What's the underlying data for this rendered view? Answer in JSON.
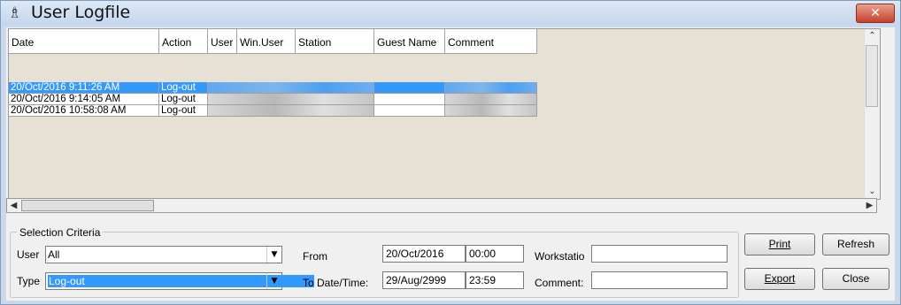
{
  "window": {
    "title": "User Logfile",
    "title_icon": "key-icon",
    "close_icon": "close-icon"
  },
  "grid": {
    "columns": [
      "Date",
      "Action",
      "User",
      "Win.User",
      "Station",
      "Guest Name",
      "Comment"
    ],
    "rows": [
      {
        "date": "20/Oct/2016 9:11:26 AM",
        "action": "Log-out",
        "selected": true
      },
      {
        "date": "20/Oct/2016 9:14:05 AM",
        "action": "Log-out",
        "selected": false
      },
      {
        "date": "20/Oct/2016 10:58:08 AM",
        "action": "Log-out",
        "selected": false
      }
    ]
  },
  "criteria": {
    "legend": "Selection Criteria",
    "user_label": "User",
    "user_value": "All",
    "type_label": "Type",
    "type_value": "Log-out",
    "from_label": "From",
    "from_date": "20/Oct/2016",
    "from_time": "00:00",
    "to_label": "To Date/Time:",
    "to_date": "29/Aug/2999",
    "to_time": "23:59",
    "workstation_label": "Workstatio",
    "workstation_value": "",
    "comment_label": "Comment:",
    "comment_value": ""
  },
  "buttons": {
    "print": "Print",
    "refresh": "Refresh",
    "export": "Export",
    "close": "Close"
  }
}
